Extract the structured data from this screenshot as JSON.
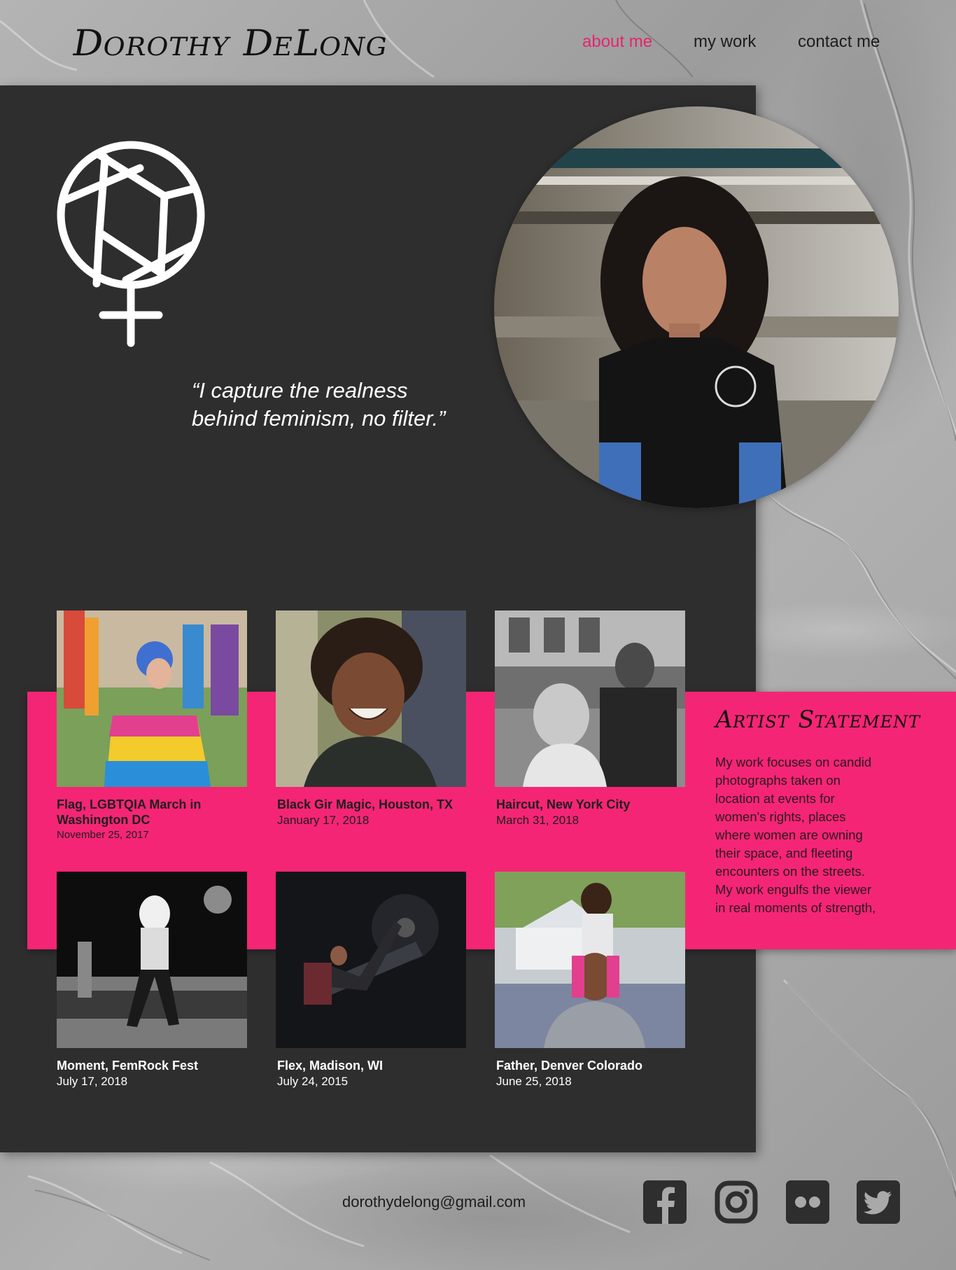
{
  "header": {
    "logo": "Dorothy DeLong",
    "nav": [
      {
        "label": "about me",
        "active": true
      },
      {
        "label": "my work",
        "active": false
      },
      {
        "label": "contact me",
        "active": false
      }
    ]
  },
  "hero": {
    "emblem_icon": "camera-aperture-venus-icon",
    "quote_line1": "“I capture the realness",
    "quote_line2": "behind feminism, no filter.”"
  },
  "gallery": [
    {
      "title_line1": "Flag, LGBTQIA March in",
      "title_line2": "Washington DC",
      "date": "November 25, 2017"
    },
    {
      "title_line1": "Black Gir Magic, Houston, TX",
      "title_line2": "",
      "date": "January 17, 2018"
    },
    {
      "title_line1": "Haircut, New York City",
      "title_line2": "",
      "date": "March 31, 2018"
    },
    {
      "title_line1": "Moment, FemRock Fest",
      "title_line2": "",
      "date": "July 17, 2018"
    },
    {
      "title_line1": "Flex, Madison, WI",
      "title_line2": "",
      "date": "July 24, 2015"
    },
    {
      "title_line1": "Father, Denver Colorado",
      "title_line2": "",
      "date": "June 25, 2018"
    }
  ],
  "statement": {
    "title": "Artist Statement",
    "lines": [
      "My work focuses on candid",
      "photographs taken on",
      "location at events for",
      "women's rights, places",
      "where women are owning",
      "their space, and fleeting",
      "encounters on the streets.",
      "My work engulfs the viewer",
      "in real moments of strength,"
    ]
  },
  "footer": {
    "email": "dorothydelong@gmail.com",
    "social_icons": [
      "facebook-icon",
      "instagram-icon",
      "flickr-icon",
      "twitter-icon"
    ]
  },
  "colors": {
    "accent": "#f52575",
    "nav_active": "#e3266f",
    "panel": "#2f2e2e",
    "background": "#a9a9a9"
  }
}
